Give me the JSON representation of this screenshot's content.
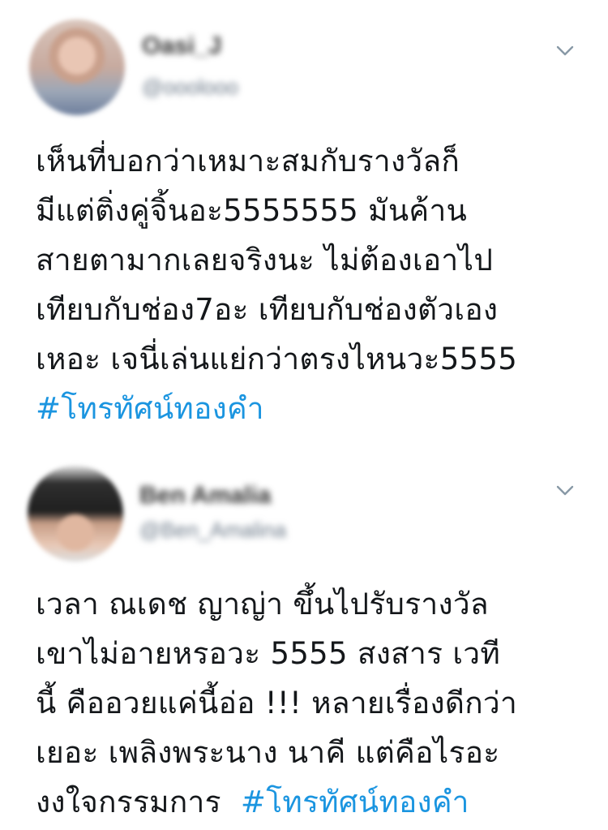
{
  "tweets": [
    {
      "display_name": "Oasi_J",
      "handle": "@ooolooo",
      "lines": [
        "เห็นที่บอกว่าเหมาะสมกับรางวัลก็",
        "มีแต่ติ่งคู่จิ้นอะ5555555 มันค้าน",
        "สายตามากเลยจริงนะ ไม่ต้องเอาไป",
        "เทียบกับช่อง7อะ เทียบกับช่องตัวเอง",
        "เหอะ เจนี่เล่นแย่กว่าตรงไหนวะ5555"
      ],
      "hashtag": "#โทรทัศน์ทองคำ"
    },
    {
      "display_name": "Ben Amalia",
      "handle": "@Ben_Amalina",
      "lines": [
        "เวลา ณเดช ญาญ่า ขึ้นไปรับรางวัล",
        "เขาไม่อายหรอวะ 5555 สงสาร เวที",
        "นี้ คืออวยแค่นี้อ่อ !!! หลายเรื่องดีกว่า",
        "เยอะ เพลิงพระนาง นาคี แต่คือไรอะ"
      ],
      "last_line_text": "งงใจกรรมการ",
      "hashtag": "#โทรทัศน์ทองคำ"
    }
  ],
  "icons": {
    "menu": "chevron-down-icon"
  },
  "colors": {
    "text": "#14171a",
    "hashtag": "#1b95e0",
    "chevron": "#8899a6"
  }
}
